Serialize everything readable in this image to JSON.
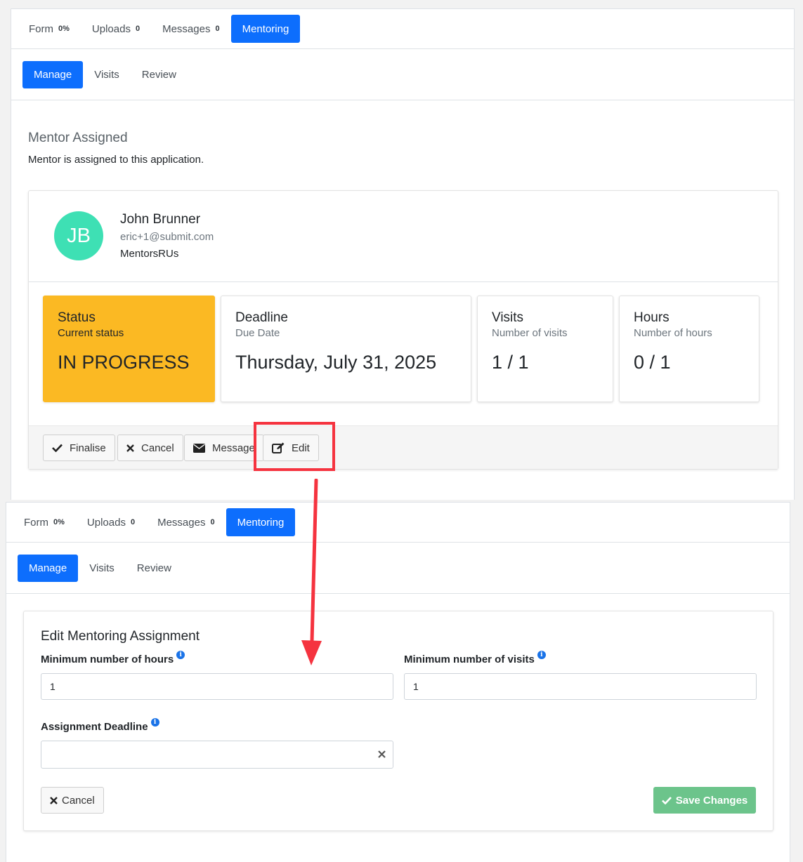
{
  "colors": {
    "primary": "#0d6efd",
    "status_warning": "#fbb923",
    "avatar": "#3ee0b4",
    "success": "#6cc48b",
    "annotation": "#f5333f"
  },
  "top": {
    "tabs": [
      {
        "label": "Form",
        "count": "0%"
      },
      {
        "label": "Uploads",
        "count": "0"
      },
      {
        "label": "Messages",
        "count": "0"
      },
      {
        "label": "Mentoring",
        "count": ""
      }
    ],
    "subtabs": [
      "Manage",
      "Visits",
      "Review"
    ],
    "section_title": "Mentor Assigned",
    "section_desc": "Mentor is assigned to this application.",
    "mentor": {
      "initials": "JB",
      "name": "John Brunner",
      "email": "eric+1@submit.com",
      "organization": "MentorsRUs"
    },
    "stats": [
      {
        "label": "Status",
        "sub": "Current status",
        "value": "IN PROGRESS"
      },
      {
        "label": "Deadline",
        "sub": "Due Date",
        "value": "Thursday, July 31, 2025"
      },
      {
        "label": "Visits",
        "sub": "Number of visits",
        "value": "1 / 1"
      },
      {
        "label": "Hours",
        "sub": "Number of hours",
        "value": "0 / 1"
      }
    ],
    "actions": [
      {
        "label": "Finalise",
        "icon": "check-icon"
      },
      {
        "label": "Cancel",
        "icon": "x-icon"
      },
      {
        "label": "Message",
        "icon": "envelope-icon"
      },
      {
        "label": "Edit",
        "icon": "edit-icon"
      }
    ]
  },
  "bottom": {
    "tabs": [
      {
        "label": "Form",
        "count": "0%"
      },
      {
        "label": "Uploads",
        "count": "0"
      },
      {
        "label": "Messages",
        "count": "0"
      },
      {
        "label": "Mentoring",
        "count": ""
      }
    ],
    "subtabs": [
      "Manage",
      "Visits",
      "Review"
    ],
    "form": {
      "title": "Edit Mentoring Assignment",
      "hours_label": "Minimum number of hours",
      "hours_value": "1",
      "visits_label": "Minimum number of visits",
      "visits_value": "1",
      "deadline_label": "Assignment Deadline",
      "deadline_value": "",
      "cancel_label": "Cancel",
      "save_label": "Save Changes"
    }
  }
}
